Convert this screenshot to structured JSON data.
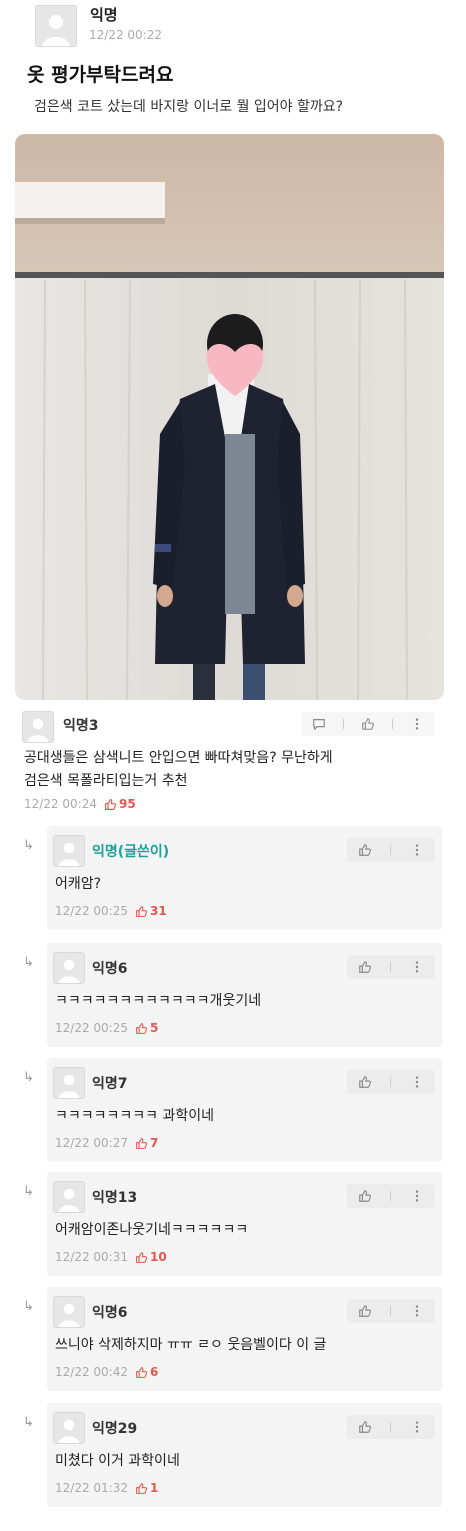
{
  "post": {
    "author": "익명",
    "time": "12/22 00:22",
    "title": "옷 평가부탁드려요",
    "body": "검은색 코트 샀는데 바지랑 이너로 뭘 입어야 할까요?"
  },
  "comment": {
    "author": "익명3",
    "text_line1": "공대생들은 삼색니트 안입으면 빠따쳐맞음? 무난하게",
    "text_line2": "검은색 목폴라티입는거 추천",
    "time": "12/22 00:24",
    "likes": "95"
  },
  "replies": [
    {
      "author": "익명(글쓴이)",
      "text": "어캐암?",
      "time": "12/22 00:25",
      "likes": "31"
    },
    {
      "author": "익명6",
      "text": "ㅋㅋㅋㅋㅋㅋㅋㅋㅋㅋㅋㅋ개웃기네",
      "time": "12/22 00:25",
      "likes": "5"
    },
    {
      "author": "익명7",
      "text": "ㅋㅋㅋㅋㅋㅋㅋㅋ 과학이네",
      "time": "12/22 00:27",
      "likes": "7"
    },
    {
      "author": "익명13",
      "text": "어캐암이존나웃기네ㅋㅋㅋㅋㅋㅋ",
      "time": "12/22 00:31",
      "likes": "10"
    },
    {
      "author": "익명6",
      "text": "쓰니야 삭제하지마 ㅠㅠ ㄹㅇ 웃음벨이다 이 글",
      "time": "12/22 00:42",
      "likes": "6"
    },
    {
      "author": "익명29",
      "text": "미쳤다 이거 과학이네",
      "time": "12/22 01:32",
      "likes": "1"
    }
  ],
  "colors": {
    "like": "#e0584f",
    "op_author": "#1aa39a"
  },
  "icons": {
    "comment": "speech-bubble-icon",
    "like": "thumbs-up-icon",
    "more": "more-vertical-icon",
    "reply": "reply-arrow-icon"
  }
}
